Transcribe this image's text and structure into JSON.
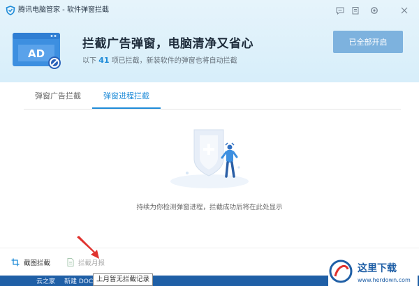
{
  "window": {
    "title": "腾讯电脑管家 - 软件弹窗拦截",
    "titlebar_icons": [
      "chat-icon",
      "clipboard-icon",
      "settings-icon",
      "close-icon"
    ]
  },
  "hero": {
    "icon_text": "AD",
    "title": "拦截广告弹窗，电脑清净又省心",
    "subtitle_prefix": "以下",
    "count": "41",
    "subtitle_suffix": "项已拦截，新装软件的弹窗也将自动拦截",
    "enable_all_label": "已全部开启"
  },
  "tabs": [
    {
      "label": "弹窗广告拦截",
      "active": false
    },
    {
      "label": "弹窗进程拦截",
      "active": true
    }
  ],
  "empty_state": {
    "message": "持续为你检测弹窗进程，拦截成功后将在此处显示"
  },
  "footer": {
    "screenshot_block_label": "截图拦截",
    "monthly_report_label": "拦截月报",
    "tooltip": "上月暂无拦截记录"
  },
  "taskbar": {
    "items": [
      "云之家",
      "新建 DOC"
    ]
  },
  "watermark": {
    "text": "这里下载",
    "url": "www.herdown.com"
  },
  "colors": {
    "accent": "#1e8bd8",
    "header_bg": "#d7eefa",
    "enable_button": "#7db2de",
    "annotation_arrow": "#e0332f",
    "taskbar": "#1f5fa6"
  }
}
